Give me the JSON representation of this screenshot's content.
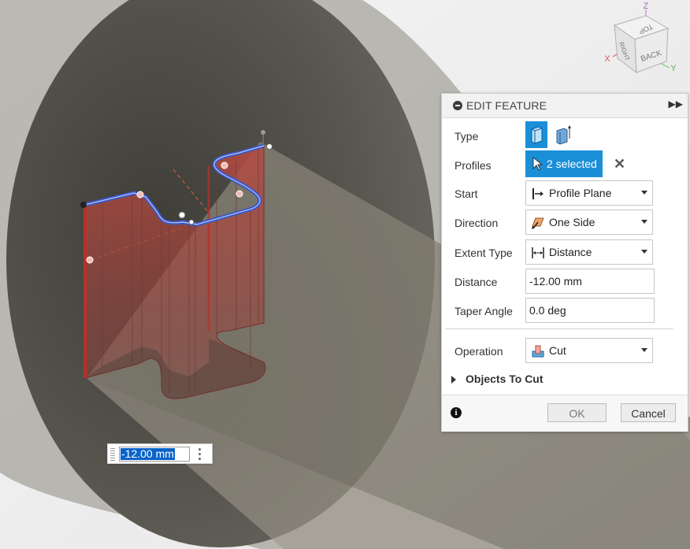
{
  "viewcube": {
    "axis_z": "Z",
    "axis_x": "X",
    "axis_y": "Y",
    "face_top": "TOP",
    "face_back": "BACK",
    "face_right": "RIGHT"
  },
  "panel": {
    "title": "EDIT FEATURE",
    "type_label": "Type",
    "profiles_label": "Profiles",
    "profiles_value": "2 selected",
    "start_label": "Start",
    "start_value": "Profile Plane",
    "direction_label": "Direction",
    "direction_value": "One Side",
    "extent_type_label": "Extent Type",
    "extent_type_value": "Distance",
    "distance_label": "Distance",
    "distance_value": "-12.00 mm",
    "taper_label": "Taper Angle",
    "taper_value": "0.0 deg",
    "operation_label": "Operation",
    "operation_value": "Cut",
    "objects_to_cut_label": "Objects To Cut",
    "ok_label": "OK",
    "cancel_label": "Cancel"
  },
  "dimension_input": {
    "value": "-12.00 mm"
  },
  "colors": {
    "accent": "#1a8fd8",
    "selection_blue": "#3a57c7",
    "cut_red": "#b82a2a"
  }
}
